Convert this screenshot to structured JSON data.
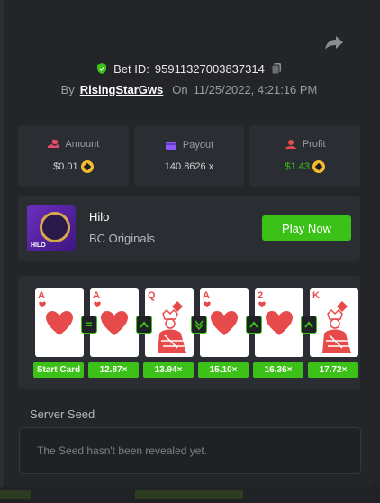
{
  "bet": {
    "id_label": "Bet ID:",
    "id": "95911327003837314",
    "by_label": "By",
    "user": "RisingStarGws",
    "on_label": "On",
    "datetime": "11/25/2022, 4:21:16 PM"
  },
  "stats": [
    {
      "label": "Amount",
      "value": "$0.01",
      "icon": "hand-coins-icon",
      "coin": true
    },
    {
      "label": "Payout",
      "value": "140.8626 x",
      "icon": "card-wallet-icon",
      "coin": false
    },
    {
      "label": "Profit",
      "value": "$1.43",
      "icon": "user-profit-icon",
      "coin": true
    }
  ],
  "game": {
    "name": "Hilo",
    "provider": "BC Originals",
    "thumb_label": "HILO",
    "play_label": "Play Now"
  },
  "cards": [
    {
      "rank": "A",
      "suit": "heart",
      "tag": "Start Card"
    },
    {
      "rank": "A",
      "suit": "heart",
      "tag": "12.87×"
    },
    {
      "rank": "Q",
      "suit": "diamond",
      "tag": "13.94×"
    },
    {
      "rank": "A",
      "suit": "heart",
      "tag": "15.10×"
    },
    {
      "rank": "2",
      "suit": "heart",
      "tag": "16.36×"
    },
    {
      "rank": "K",
      "suit": "diamond",
      "tag": "17.72×"
    }
  ],
  "connectors": [
    "=",
    "^",
    "v",
    "^",
    "^"
  ],
  "seed": {
    "label": "Server Seed",
    "text": "The Seed hasn't been revealed yet."
  },
  "colors": {
    "accent": "#3bc117",
    "card_red": "#e64a4a",
    "bg": "#232529"
  }
}
